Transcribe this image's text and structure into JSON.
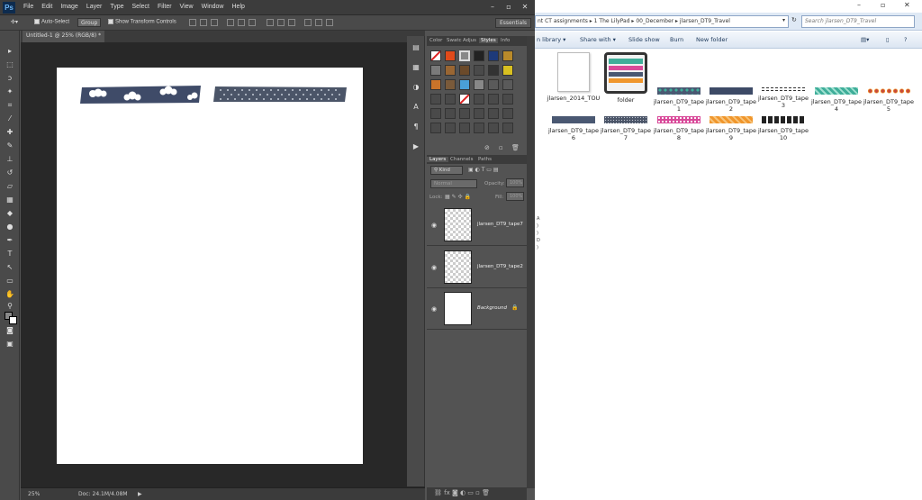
{
  "photoshop": {
    "logo": "Ps",
    "menus": [
      "File",
      "Edit",
      "Image",
      "Layer",
      "Type",
      "Select",
      "Filter",
      "View",
      "Window",
      "Help"
    ],
    "options": {
      "auto_select": "Auto-Select",
      "group": "Group",
      "show_transform": "Show Transform Controls",
      "workspace": "Essentials"
    },
    "doc_tab": "Untitled-1 @ 25% (RGB/8) *",
    "status": {
      "zoom": "25%",
      "doc": "Doc: 24.1M/4.08M"
    },
    "styles_tabs": [
      "Color",
      "Swatc",
      "Adjus",
      "Styles",
      "Info"
    ],
    "layers_tabs": [
      "Layers",
      "Channels",
      "Paths"
    ],
    "layers_controls": {
      "kind": "Kind",
      "blend": "Normal",
      "opacity_label": "Opacity:",
      "opacity": "100%",
      "lock_label": "Lock:",
      "fill_label": "Fill:",
      "fill": "100%"
    },
    "layers": [
      {
        "name": "jlarsen_DT9_tape7"
      },
      {
        "name": "jlarsen_DT9_tape2"
      },
      {
        "name": "Background"
      }
    ]
  },
  "explorer": {
    "address": "nt CT assignments  ▸  1 The LilyPad  ▸  00_December  ▸  jlarsen_DT9_Travel",
    "search_placeholder": "Search jlarsen_DT9_Travel",
    "commands": [
      "n library ▾",
      "Share with ▾",
      "Slide show",
      "Burn",
      "New folder"
    ],
    "files": [
      {
        "label": "jlarsen_2014_TOU",
        "kind": "doc"
      },
      {
        "label": "folder",
        "kind": "folder"
      },
      {
        "label": "jlarsen_DT9_tape 1",
        "color": "#4a5872"
      },
      {
        "label": "jlarsen_DT9_tape 2",
        "color": "#3d4a66"
      },
      {
        "label": "jlarsen_DT9_tape 3",
        "color": "#333"
      },
      {
        "label": "jlarsen_DT9_tape 4",
        "color": "#3fae9a"
      },
      {
        "label": "jlarsen_DT9_tape 5",
        "color": "#c94a3a"
      },
      {
        "label": "jlarsen_DT9_tape 6",
        "color": "#4a5872"
      },
      {
        "label": "jlarsen_DT9_tape 7",
        "color": "#4b5568"
      },
      {
        "label": "jlarsen_DT9_tape 8",
        "color": "#d94a9a"
      },
      {
        "label": "jlarsen_DT9_tape 9",
        "color": "#f0962c"
      },
      {
        "label": "jlarsen_DT9_tape 10",
        "color": "#222"
      }
    ]
  }
}
